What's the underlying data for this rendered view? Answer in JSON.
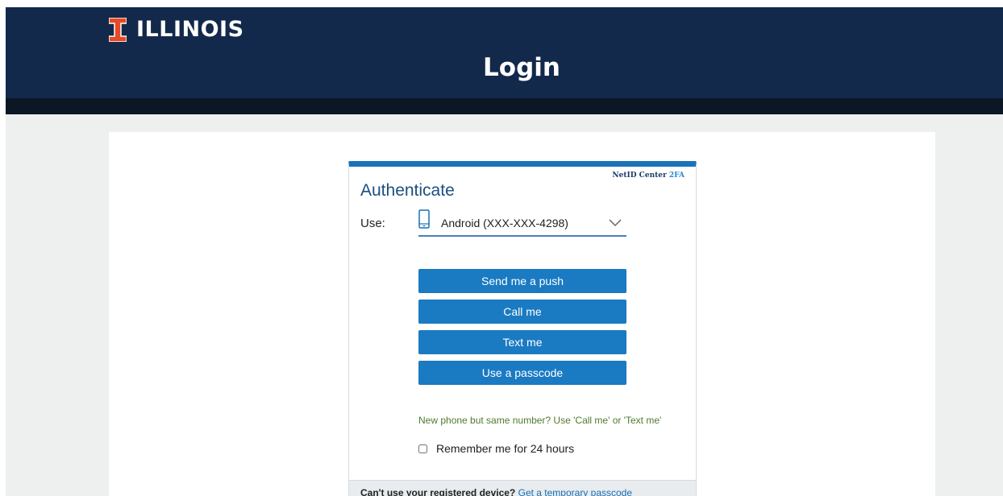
{
  "header": {
    "brand": "ILLINOIS",
    "title": "Login"
  },
  "duo": {
    "badge_main": "NetID Center",
    "badge_suffix": "2FA",
    "heading": "Authenticate",
    "use_label": "Use:",
    "device": "Android (XXX-XXX-4298)",
    "device_icon": "phone-icon",
    "buttons": {
      "push": "Send me a push",
      "call": "Call me",
      "text": "Text me",
      "passcode": "Use a passcode"
    },
    "note": "New phone but same number? Use 'Call me' or 'Text me'",
    "remember": "Remember me for 24 hours",
    "footer": {
      "question": "Can't use your registered device?",
      "link": "Get a temporary passcode"
    }
  },
  "colors": {
    "header_bg": "#13294b",
    "brand_orange": "#e84a27",
    "button_blue": "#1a7ac2",
    "note_green": "#4f7a2e"
  }
}
